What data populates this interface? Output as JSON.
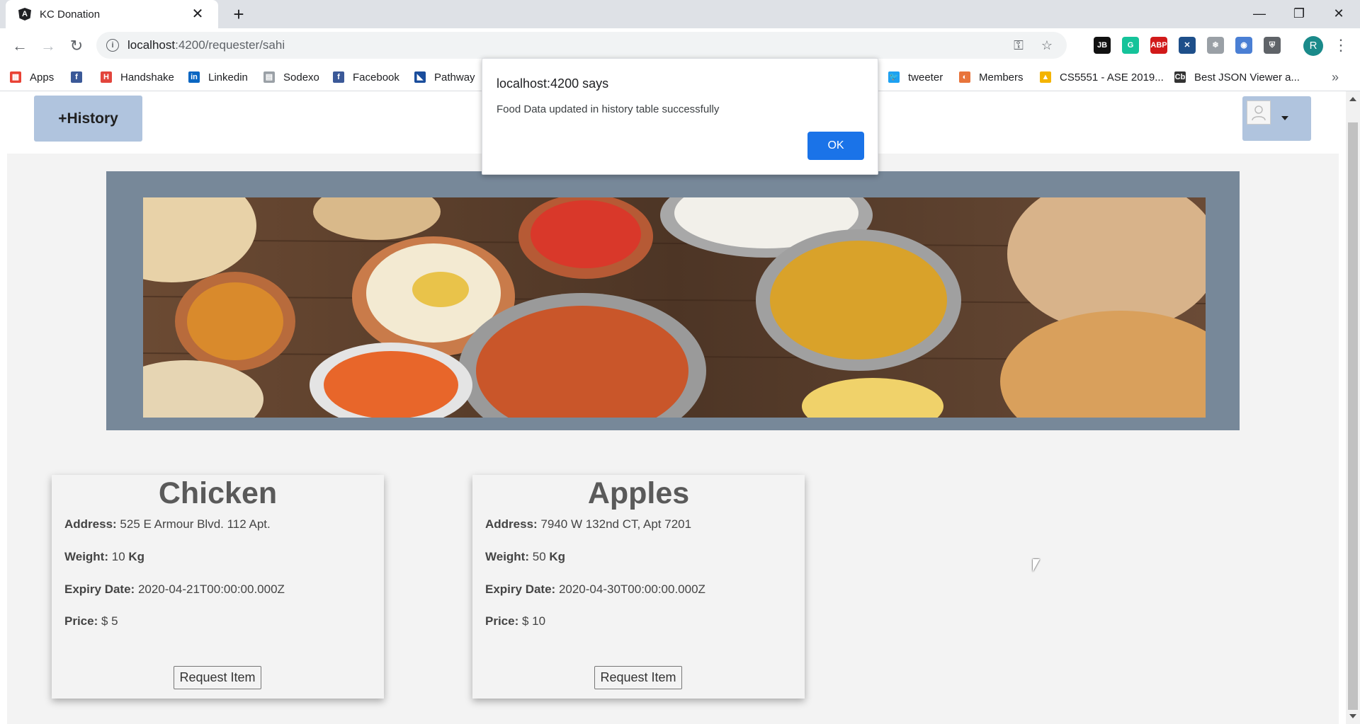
{
  "browser": {
    "tab_title": "KC Donation",
    "tab_close": "✕",
    "new_tab": "+",
    "url_host": "localhost",
    "url_path": ":4200/requester/sahi",
    "profile_initial": "R",
    "window_controls": [
      "—",
      "❐",
      "✕"
    ],
    "extensions": [
      {
        "icon": "jetbrains-icon",
        "text": "JB",
        "color": "#111111"
      },
      {
        "icon": "grammarly-icon",
        "text": "G",
        "color": "#15c39a"
      },
      {
        "icon": "adblock-icon",
        "text": "ABP",
        "color": "#d11a1a"
      },
      {
        "icon": "vscode-icon",
        "text": "✕",
        "color": "#1e4f8a"
      },
      {
        "icon": "extension-gear-icon",
        "text": "❄",
        "color": "#9aa0a6"
      },
      {
        "icon": "screenshot-icon",
        "text": "◉",
        "color": "#4a7fd4"
      },
      {
        "icon": "shield-extension-icon",
        "text": "⛨",
        "color": "#5f6368"
      }
    ]
  },
  "bookmarks": [
    {
      "label": "Apps",
      "icon": "apps-grid-icon",
      "color": "#e94235"
    },
    {
      "label": "",
      "icon": "facebook-icon",
      "color": "#3b5998"
    },
    {
      "label": "Handshake",
      "icon": "handshake-icon",
      "color": "#e2453c"
    },
    {
      "label": "Linkedin",
      "icon": "linkedin-icon",
      "color": "#0a66c2"
    },
    {
      "label": "Sodexo",
      "icon": "document-icon",
      "color": "#9aa0a6"
    },
    {
      "label": "Facebook",
      "icon": "facebook-icon",
      "color": "#3b5998"
    },
    {
      "label": "Pathway",
      "icon": "pathway-icon",
      "color": "#1a4d9c"
    },
    {
      "label": "tweeter",
      "icon": "twitter-icon",
      "color": "#1da1f2"
    },
    {
      "label": "Members",
      "icon": "members-icon",
      "color": "#e8743b"
    },
    {
      "label": "CS5551 - ASE 2019...",
      "icon": "google-drive-icon",
      "color": "#f4b400"
    },
    {
      "label": "Best JSON Viewer a...",
      "icon": "codebeautify-icon",
      "color": "#333333"
    }
  ],
  "bookmarks_more": "»",
  "page": {
    "history_button": "+History",
    "cards": [
      {
        "title": "Chicken",
        "address_label": "Address:",
        "address": "525 E Armour Blvd. 112 Apt.",
        "weight_label": "Weight:",
        "weight": "10",
        "weight_unit": "Kg",
        "expiry_label": "Expiry Date:",
        "expiry": "2020-04-21T00:00:00.000Z",
        "price_label": "Price:",
        "price": "$ 5",
        "button": "Request Item"
      },
      {
        "title": "Apples",
        "address_label": "Address:",
        "address": "7940 W 132nd CT, Apt 7201",
        "weight_label": "Weight:",
        "weight": "50",
        "weight_unit": "Kg",
        "expiry_label": "Expiry Date:",
        "expiry": "2020-04-30T00:00:00.000Z",
        "price_label": "Price:",
        "price": "$ 10",
        "button": "Request Item"
      }
    ]
  },
  "alert": {
    "title": "localhost:4200 says",
    "message": "Food Data updated in history table successfully",
    "ok": "OK"
  }
}
